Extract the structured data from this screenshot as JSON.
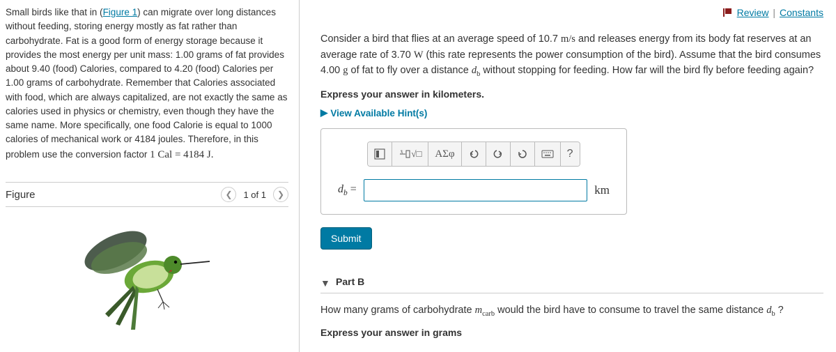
{
  "leftPanel": {
    "intro_prefix": "Small birds like that in (",
    "intro_link": "Figure 1",
    "intro_suffix": ") can migrate over long distances without feeding, storing energy mostly as fat rather than carbohydrate. Fat is a good form of energy storage because it provides the most energy per unit mass: 1.00 grams of fat provides about 9.40 (food) Calories, compared to 4.20 (food) Calories per 1.00 grams of carbohydrate. Remember that Calories associated with food, which are always capitalized, are not exactly the same as calories used in physics or chemistry, even though they have the same name. More specifically, one food Calorie is equal to 1000 calories of mechanical work or 4184 joules. Therefore, in this problem use the conversion factor ",
    "conversion": "1 Cal = 4184 J.",
    "figure_title": "Figure",
    "fig_counter": "1 of 1"
  },
  "topLinks": {
    "review": "Review",
    "constants": "Constants"
  },
  "partA": {
    "prompt_1": "Consider a bird that flies at an average speed of 10.7 ",
    "units_1": "m/s",
    "prompt_2": " and releases energy from its body fat reserves at an average rate of 3.70 ",
    "units_2": "W",
    "prompt_3": " (this rate represents the power consumption of the bird). Assume that the bird consumes 4.00 ",
    "units_3": "g",
    "prompt_4": " of fat to fly over a distance ",
    "var_db": "d",
    "var_db_sub": "b",
    "prompt_5": " without stopping for feeding. How far will the bird fly before feeding again?",
    "instruction": "Express your answer in kilometers.",
    "hints_label": "View Available Hint(s)",
    "eq_lhs": "d",
    "eq_lhs_sub": "b",
    "eq_sign": " =",
    "unit": "km",
    "toolbar": {
      "greek": "ΑΣφ",
      "help": "?"
    },
    "submit": "Submit"
  },
  "partB": {
    "header": "Part B",
    "prompt_1": "How many grams of carbohydrate ",
    "var_m": "m",
    "var_m_sub": "carb",
    "prompt_2": " would the bird have to consume to travel the same distance ",
    "var_db": "d",
    "var_db_sub": "b",
    "prompt_3": " ?",
    "instruction": "Express your answer in grams"
  }
}
